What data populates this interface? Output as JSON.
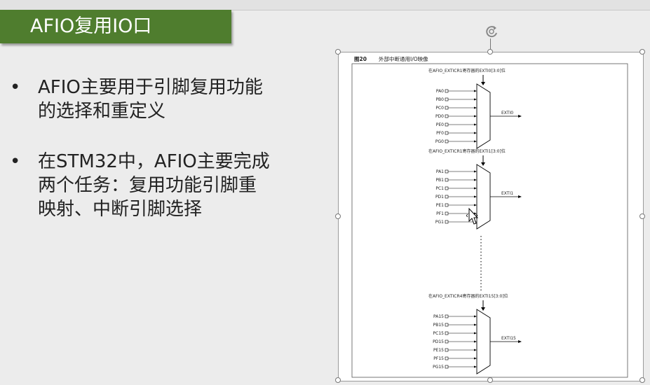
{
  "slide": {
    "title": "AFIO复用IO口",
    "bullets": [
      {
        "lines": [
          "AFIO主要用于引脚复用功能",
          "的选择和重定义"
        ]
      },
      {
        "lines": [
          "在STM32中，AFIO主要完成",
          "两个任务：复用功能引脚重",
          "映射、中断引脚选择"
        ]
      }
    ]
  },
  "figure": {
    "caption_num": "图20",
    "caption_text": "外部中断通用I/O映像",
    "groups": [
      {
        "header": "在AFIO_EXTICR1寄存器的EXTI0[3:0]位",
        "inputs": [
          "PA0",
          "PB0",
          "PC0",
          "PD0",
          "PE0",
          "PF0",
          "PG0"
        ],
        "output": "EXTI0"
      },
      {
        "header": "在AFIO_EXTICR1寄存器的EXTI1[3:0]位",
        "inputs": [
          "PA1",
          "PB1",
          "PC1",
          "PD1",
          "PE1",
          "PF1",
          "PG1"
        ],
        "output": "EXTI1"
      },
      {
        "header": "在AFIO_EXTICR4寄存器的EXTI15[3:0]位",
        "inputs": [
          "PA15",
          "PB15",
          "PC15",
          "PD15",
          "PE15",
          "PF15",
          "PG15"
        ],
        "output": "EXTI15"
      }
    ]
  },
  "icons": {
    "rotate": "rotate-handle-icon",
    "cursor": "move-cursor-icon"
  }
}
